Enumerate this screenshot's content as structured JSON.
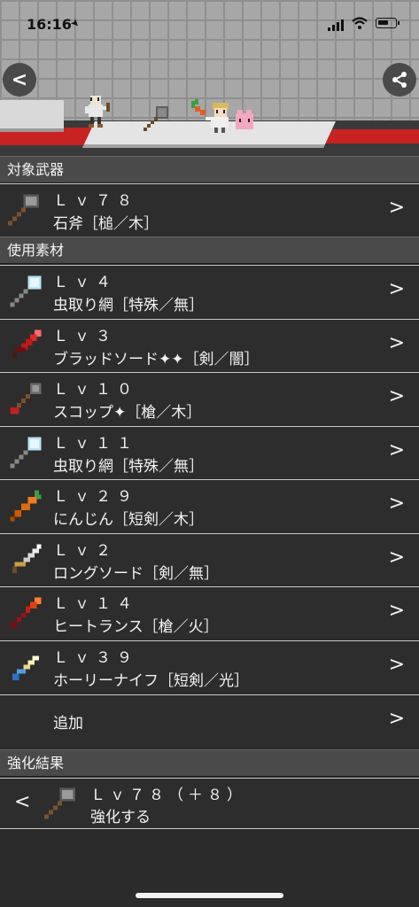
{
  "status": {
    "time": "16:16"
  },
  "colors": {
    "background": "#2b2b2b",
    "section": "#4a4a4a",
    "stripe": "#c82222"
  },
  "sections": {
    "target": "対象武器",
    "materials": "使用素材",
    "result": "強化結果"
  },
  "target_weapon": {
    "level": "Ｌｖ７８",
    "name": "石斧［槌／木］",
    "icon": "stone-axe-icon"
  },
  "materials": [
    {
      "level": "Ｌｖ４",
      "name": "虫取り網［特殊／無］",
      "icon": "bug-net-icon"
    },
    {
      "level": "Ｌｖ３",
      "name": "ブラッドソード✦✦［剣／闇］",
      "icon": "blood-sword-icon"
    },
    {
      "level": "Ｌｖ１０",
      "name": "スコップ✦［槍／木］",
      "icon": "shovel-icon"
    },
    {
      "level": "Ｌｖ１１",
      "name": "虫取り網［特殊／無］",
      "icon": "bug-net-icon"
    },
    {
      "level": "Ｌｖ２９",
      "name": "にんじん［短剣／木］",
      "icon": "carrot-icon"
    },
    {
      "level": "Ｌｖ２",
      "name": "ロングソード［剣／無］",
      "icon": "long-sword-icon"
    },
    {
      "level": "Ｌｖ１４",
      "name": "ヒートランス［槍／火］",
      "icon": "heat-lance-icon"
    },
    {
      "level": "Ｌｖ３９",
      "name": "ホーリーナイフ［短剣／光］",
      "icon": "holy-knife-icon"
    }
  ],
  "add_label": "追加",
  "result": {
    "level": "Ｌｖ７８（＋８）",
    "action": "強化する",
    "icon": "stone-axe-icon"
  }
}
